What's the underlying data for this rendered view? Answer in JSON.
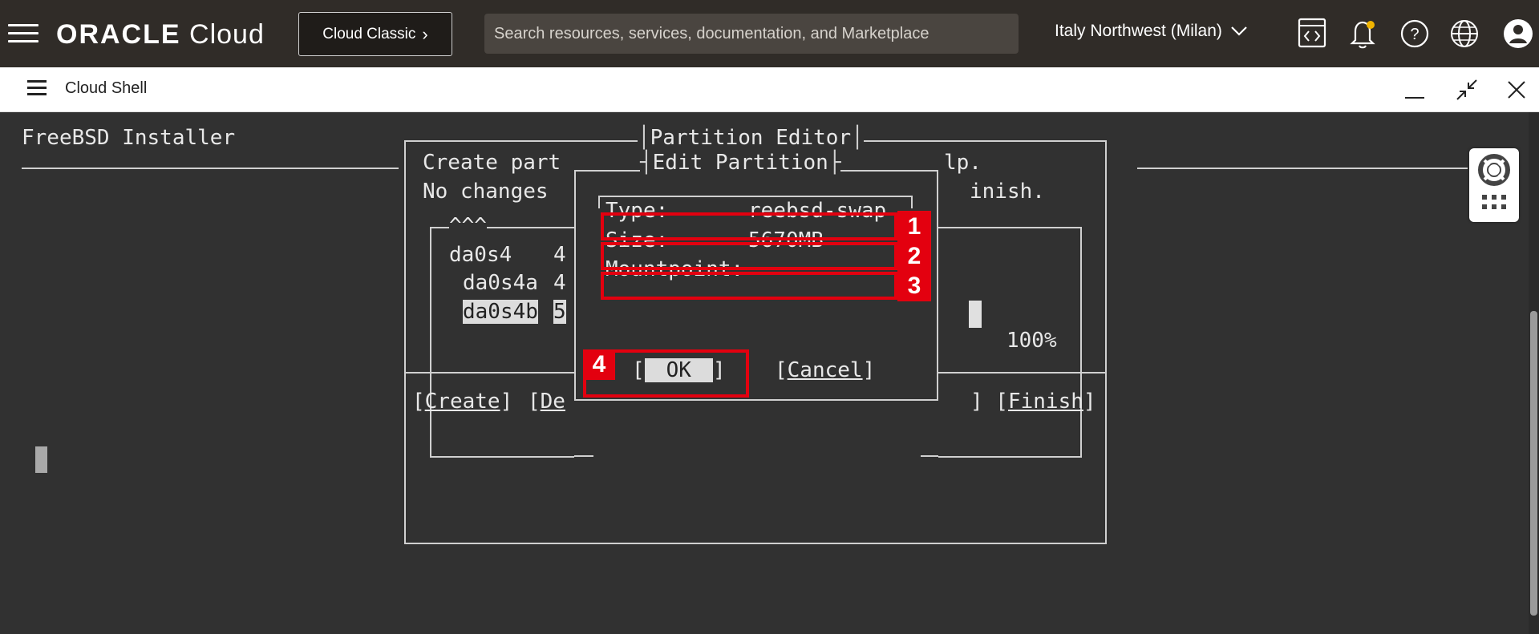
{
  "topbar": {
    "logo_bold": "ORACLE",
    "logo_light": "Cloud",
    "classic_label": "Cloud Classic",
    "search_placeholder": "Search resources, services, documentation, and Marketplace",
    "region": "Italy Northwest (Milan)"
  },
  "shell": {
    "title": "Cloud Shell"
  },
  "terminal": {
    "installer_title": "FreeBSD Installer",
    "partition_editor_title": "Partition Editor",
    "create_line": "Create part",
    "nochanges_line": "No changes",
    "help_fragment": "lp.",
    "finish_fragment": "inish.",
    "carets": "^^^",
    "rows": [
      {
        "name": "da0s4",
        "size": "4"
      },
      {
        "name": "da0s4a",
        "size": "4"
      },
      {
        "name": "da0s4b",
        "size": "5"
      }
    ],
    "percent": "100%",
    "create_btn": "Create",
    "de_fragment": "De",
    "finish_btn": "Finish",
    "edit_title": "Edit Partition",
    "type_label": "Type:",
    "type_value": "reebsd-swap",
    "size_label": "Size:",
    "size_value": "5670MB",
    "mount_label": "Mountpoint:",
    "ok_label": "OK",
    "cancel_label": "Cancel"
  },
  "annotations": [
    "1",
    "2",
    "3",
    "4"
  ],
  "colors": {
    "topbar": "#302c28",
    "terminal_bg": "#313131",
    "annotation_red": "#e3000f"
  }
}
